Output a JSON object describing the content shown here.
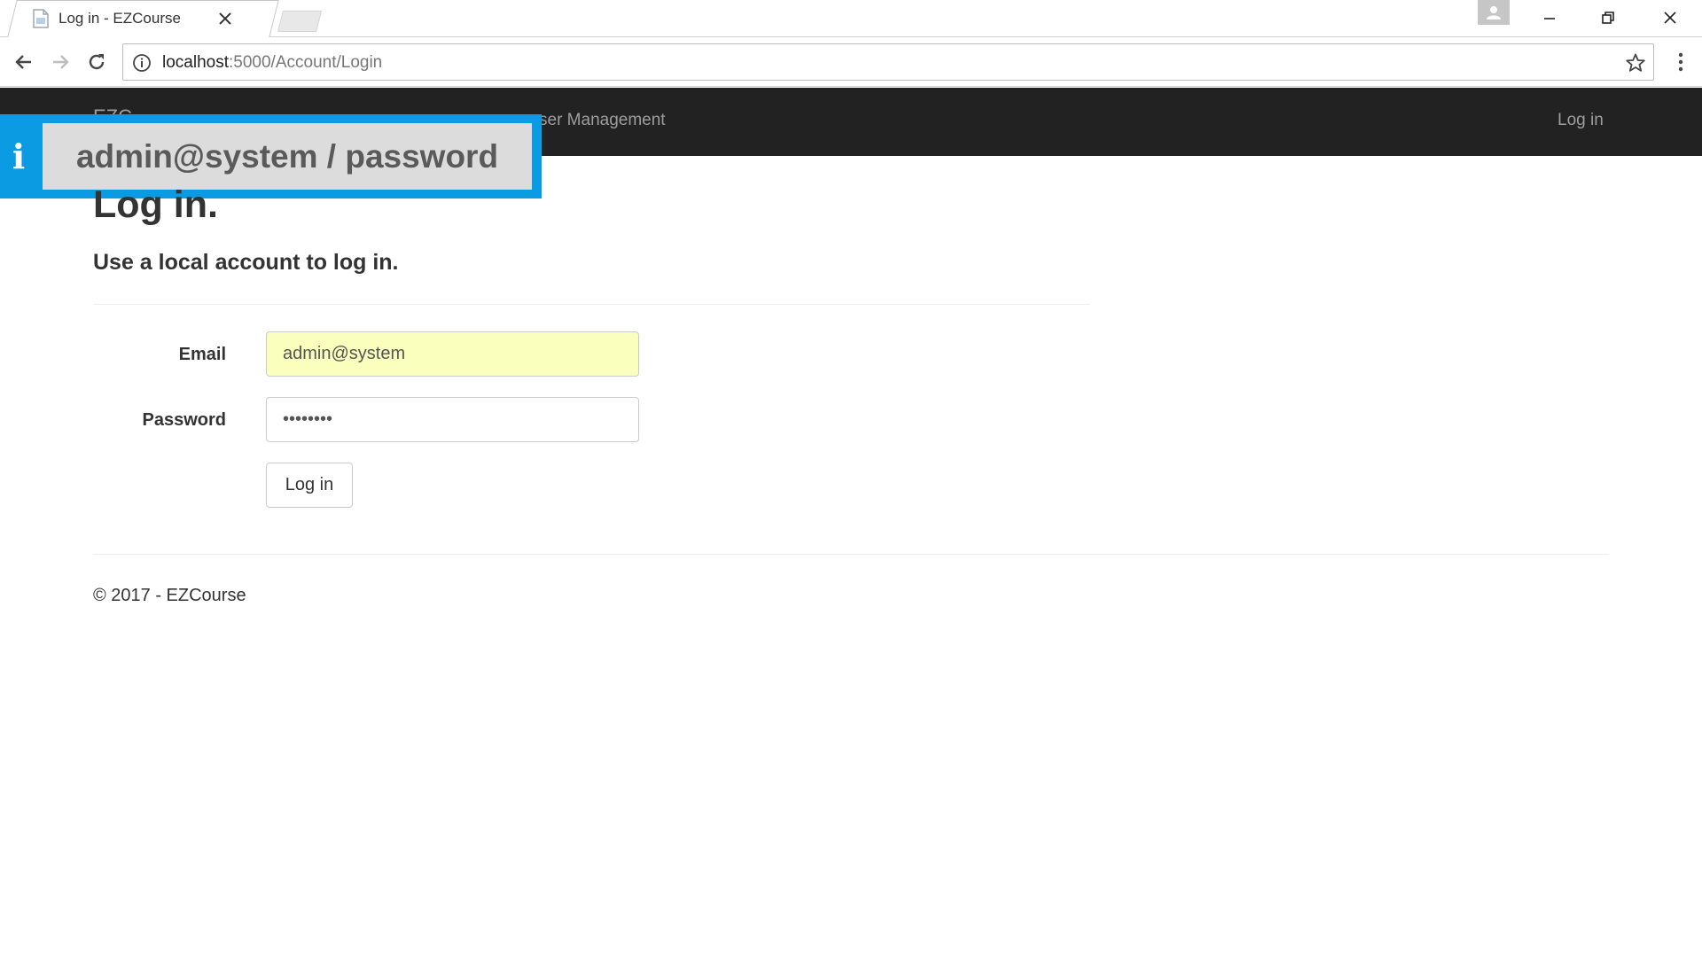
{
  "browser": {
    "tab_title": "Log in - EZCourse",
    "url_host": "localhost",
    "url_rest": ":5000/Account/Login"
  },
  "navbar": {
    "brand": "EZC",
    "links": [
      "ser Management"
    ],
    "login_link": "Log in"
  },
  "callout": {
    "text": "admin@system / password",
    "icon": "i"
  },
  "page": {
    "title": "Log in.",
    "subtitle": "Use a local account to log in."
  },
  "form": {
    "email_label": "Email",
    "email_value": "admin@system",
    "password_label": "Password",
    "password_value": "••••••••",
    "submit_label": "Log in"
  },
  "footer": {
    "text": "© 2017 - EZCourse"
  },
  "colors": {
    "navbar_bg": "#222222",
    "callout_accent": "#0a9be3",
    "autofill_bg": "#faffbd"
  }
}
